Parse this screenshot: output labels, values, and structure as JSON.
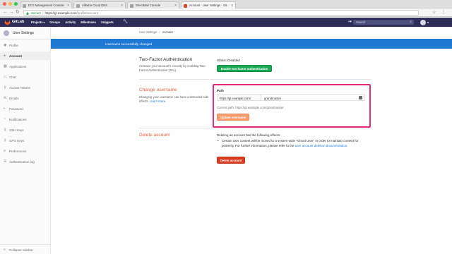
{
  "browser": {
    "tabs": [
      {
        "label": "ECS Management Console",
        "active": false
      },
      {
        "label": "Alibaba Cloud DNS",
        "active": false
      },
      {
        "label": "DirectMail Console",
        "active": false
      },
      {
        "label": "Account · User Settings · Git...",
        "active": true
      }
    ],
    "url": {
      "secure": "Secure",
      "host": "https://gl.example.com",
      "path": "/profile/account"
    },
    "traffic_colors": [
      "#fc605b",
      "#fdbc40",
      "#34c84a"
    ]
  },
  "header": {
    "brand": "GitLab",
    "nav": [
      {
        "label": "Projects",
        "has_caret": true
      },
      {
        "label": "Groups",
        "has_caret": false
      },
      {
        "label": "Activity",
        "has_caret": false
      },
      {
        "label": "Milestones",
        "has_caret": false
      },
      {
        "label": "Snippets",
        "has_caret": false
      }
    ],
    "search_placeholder": "Search",
    "icons": [
      "wrench-icon",
      "plus-icon",
      "search-icon",
      "avatar"
    ],
    "bg_color": "#2d2d57"
  },
  "sidebar": {
    "title": "User Settings",
    "items": [
      {
        "label": "Profile",
        "icon": "profile-icon",
        "active": false
      },
      {
        "label": "Account",
        "icon": "account-icon",
        "active": true
      },
      {
        "label": "Applications",
        "icon": "applications-icon",
        "active": false
      },
      {
        "label": "Chat",
        "icon": "chat-icon",
        "active": false
      },
      {
        "label": "Access Tokens",
        "icon": "key-icon",
        "active": false
      },
      {
        "label": "Emails",
        "icon": "email-icon",
        "active": false
      },
      {
        "label": "Password",
        "icon": "lock-icon",
        "active": false
      },
      {
        "label": "Notifications",
        "icon": "bell-icon",
        "active": false
      },
      {
        "label": "SSH Keys",
        "icon": "key-icon",
        "active": false
      },
      {
        "label": "GPG Keys",
        "icon": "key-icon",
        "active": false
      },
      {
        "label": "Preferences",
        "icon": "preferences-icon",
        "active": false
      },
      {
        "label": "Authentication log",
        "icon": "log-icon",
        "active": false
      }
    ],
    "collapse_label": "Collapse sidebar"
  },
  "breadcrumb": {
    "parent": "User Settings",
    "current": "Account"
  },
  "flash": {
    "message": "Username successfully changed",
    "color": "#1f78d1"
  },
  "two_factor": {
    "title": "Two-Factor Authentication",
    "description": "Increase your account's security by enabling Two-Factor Authentication (2FA).",
    "status": "Status: Disabled",
    "button_label": "Enable two-factor authentication"
  },
  "change_username": {
    "title": "Change username",
    "description": "Changing your username can have unintended side effects.",
    "learn_more": "Learn more.",
    "field_label": "Path",
    "prefix": "https://gl.example.com/",
    "value": "grandmaster",
    "current_path": "Current path: https://gl.example.com/grandmaster",
    "button_label": "Update username",
    "highlight_color": "#e52c7a"
  },
  "delete_account": {
    "title": "Delete account",
    "intro": "Deleting an account has the following effects:",
    "bullet_text": "Certain user content will be moved to a system-wide \"Ghost User\" in order to maintain content for posterity. For further information, please refer to the",
    "bullet_link": "user account deletion documentation",
    "bullet_end": ".",
    "button_label": "Delete account"
  }
}
